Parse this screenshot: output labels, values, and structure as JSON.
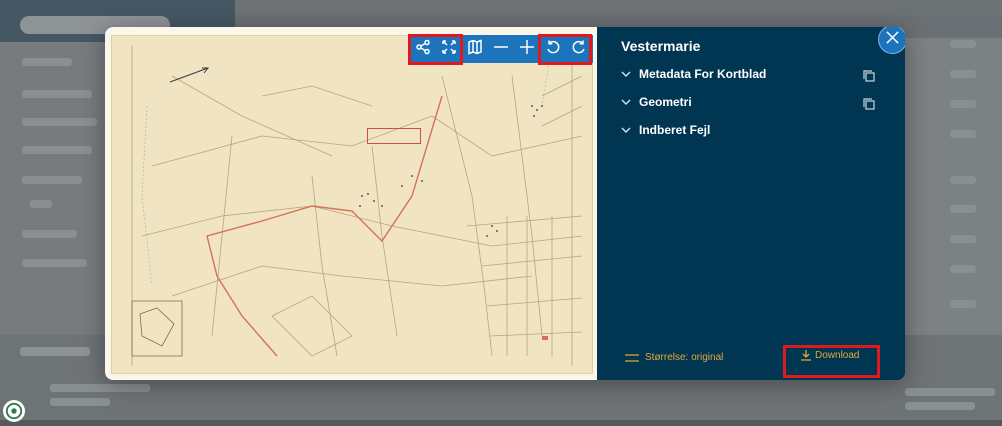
{
  "modal": {
    "title": "Vestermarie",
    "accordion": [
      {
        "label": "Metadata For Kortblad",
        "copyable": true
      },
      {
        "label": "Geometri",
        "copyable": true
      },
      {
        "label": "Indberet Fejl",
        "copyable": false
      }
    ],
    "size_label": "Størrelse: original",
    "download_label": "Download",
    "colors": {
      "panel_bg": "#003652",
      "toolbar_bg": "#1c75bc",
      "accent_orange": "#e3a63a",
      "highlight_red": "#e0191f"
    }
  },
  "map_toolbar": {
    "icons": [
      "share-icon",
      "fullscreen-icon",
      "map-layers-icon",
      "zoom-out-icon",
      "zoom-in-icon",
      "rotate-left-icon",
      "rotate-right-icon"
    ]
  }
}
